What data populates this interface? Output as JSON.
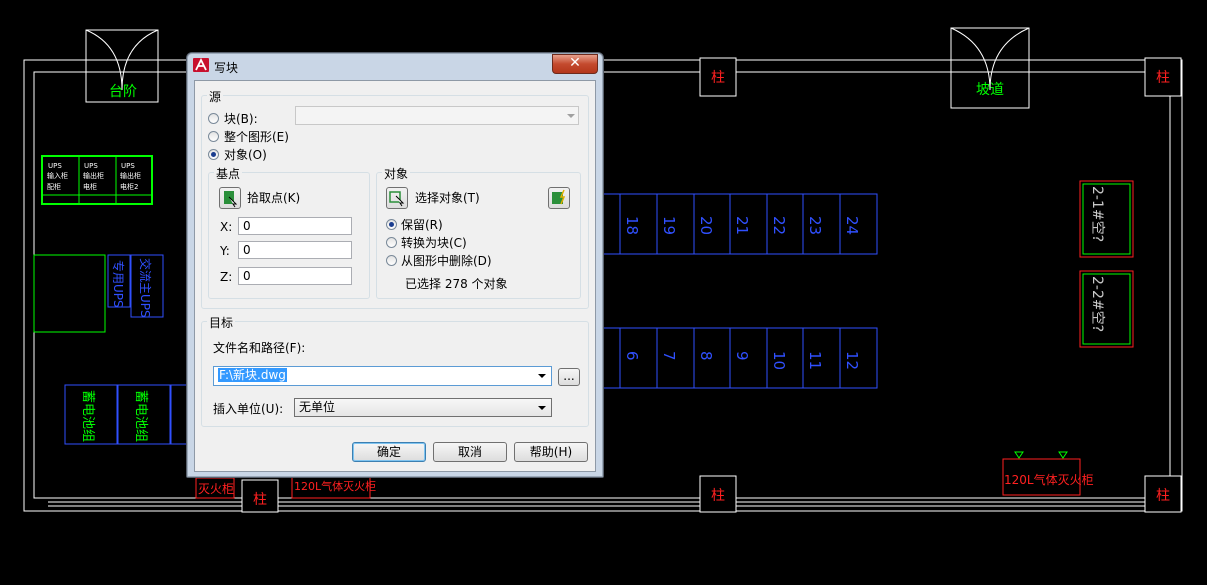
{
  "drawing": {
    "labels": {
      "steps": "台阶",
      "ramp": "坡道",
      "column": "柱",
      "ups_a": "UPS",
      "ups_b": "UPS",
      "ups_c": "UPS",
      "ups_row2_a": "输入柜",
      "ups_row2_b": "输出柜",
      "ups_row2_c": "输出柜",
      "ups_row3_a": "配柜",
      "ups_row3_b": "电柜",
      "ups_row3_c": "电柜2",
      "ups_vert_1": "专用UPS",
      "ups_vert_2": "交流主UPS",
      "battery_1": "蓄电池组",
      "battery_2": "蓄电池组",
      "ac_1": "2-1#空?",
      "ac_2": "2-2#空?",
      "fire_cabinet_small": "灭火柜",
      "fire_cabinet_left": "120L气体灭火柜",
      "fire_cabinet_right": "120L气体灭火柜"
    },
    "racks_top": [
      "18",
      "19",
      "20",
      "21",
      "22",
      "23",
      "24"
    ],
    "racks_bottom": [
      "6",
      "7",
      "8",
      "9",
      "10",
      "11",
      "12"
    ]
  },
  "dialog": {
    "icon": "autocad-logo-icon",
    "title": "写块",
    "close_label": "✕",
    "source": {
      "group_title": "源",
      "block_label": "块(B):",
      "whole_drawing_label": "整个图形(E)",
      "objects_label": "对象(O)",
      "selected": "objects"
    },
    "base_point": {
      "group_title": "基点",
      "pick_label": "拾取点(K)",
      "x_label": "X:",
      "y_label": "Y:",
      "z_label": "Z:",
      "x_value": "0",
      "y_value": "0",
      "z_value": "0"
    },
    "objects": {
      "group_title": "对象",
      "select_label": "选择对象(T)",
      "retain_label": "保留(R)",
      "convert_label": "转换为块(C)",
      "delete_label": "从图形中删除(D)",
      "selected_option": "retain",
      "count_text": "已选择 278 个对象"
    },
    "destination": {
      "group_title": "目标",
      "file_label": "文件名和路径(F):",
      "file_value": "F:\\新块.dwg",
      "browse_label": "...",
      "units_label": "插入单位(U):",
      "units_value": "无单位"
    },
    "buttons": {
      "ok": "确定",
      "cancel": "取消",
      "help": "帮助(H)"
    }
  }
}
